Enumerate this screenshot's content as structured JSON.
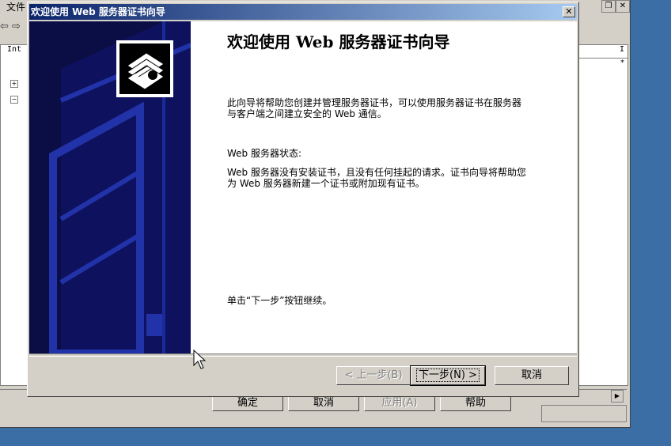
{
  "background_window": {
    "menu_first": "文件",
    "tree_header": "Int",
    "right_header": "I",
    "right_marker": "*",
    "buttons": {
      "ok": "确定",
      "cancel": "取消",
      "apply": "应用(A)",
      "help": "帮助"
    }
  },
  "wizard": {
    "title": "欢迎使用 Web 服务器证书向导",
    "heading": "欢迎使用 Web 服务器证书向导",
    "intro": "此向导将帮助您创建并管理服务器证书，可以使用服务器证书在服务器与客户端之间建立安全的 Web 通信。",
    "status_label": "Web 服务器状态:",
    "status_text": "Web 服务器没有安装证书，且没有任何挂起的请求。证书向导将帮助您为 Web 服务器新建一个证书或附加现有证书。",
    "continue_text": "单击“下一步”按钮继续。",
    "buttons": {
      "back": "< 上一步(B)",
      "next": "下一步(N) >",
      "cancel": "取消"
    }
  },
  "colors": {
    "desktop": "#3a6ea5",
    "titlebar_start": "#0a246a",
    "side_panel": "#0b0d45",
    "side_accent": "#1a2a9a"
  }
}
